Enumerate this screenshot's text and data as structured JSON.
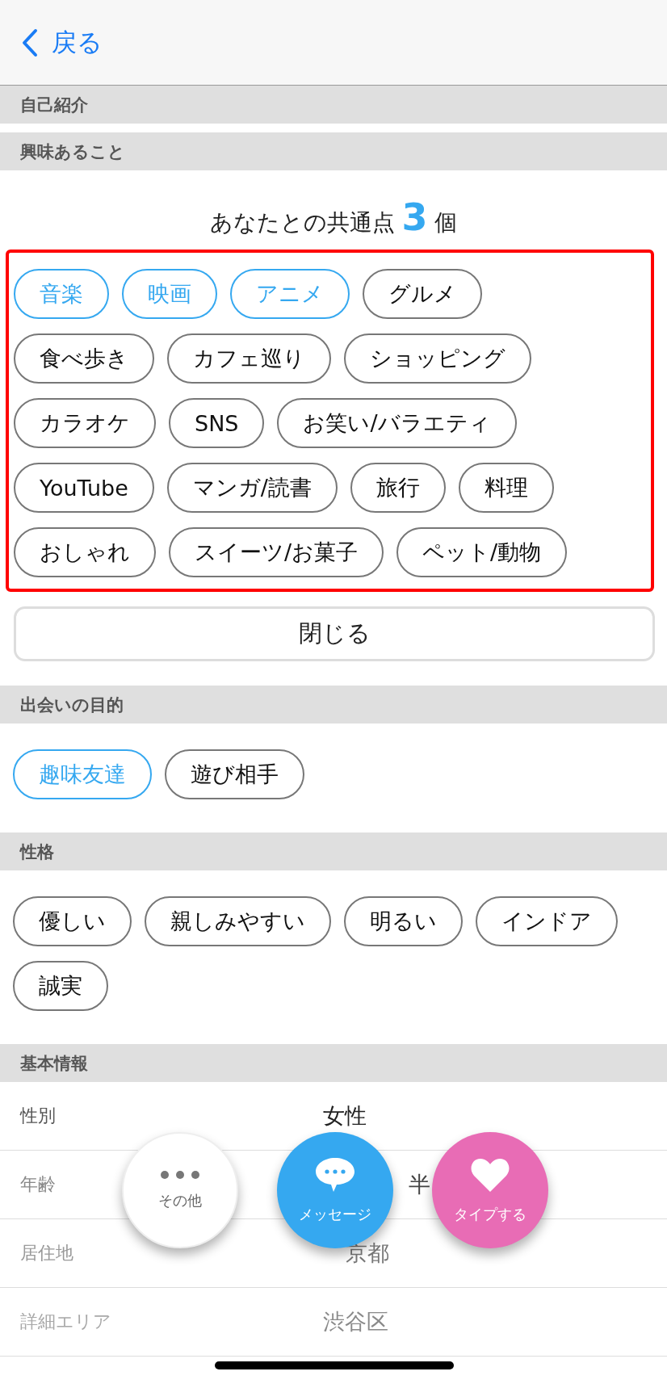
{
  "nav": {
    "back": "戻る"
  },
  "sections": [
    {
      "kind": "header",
      "title": "自己紹介"
    },
    {
      "kind": "interests",
      "title": "興味あること",
      "common": {
        "before": "あなたとの共通点",
        "count": "3",
        "after": "個"
      },
      "chips": [
        {
          "label": "音楽",
          "selected": true
        },
        {
          "label": "映画",
          "selected": true
        },
        {
          "label": "アニメ",
          "selected": true
        },
        {
          "label": "グルメ",
          "selected": false
        },
        {
          "label": "食べ歩き",
          "selected": false
        },
        {
          "label": "カフェ巡り",
          "selected": false
        },
        {
          "label": "ショッピング",
          "selected": false
        },
        {
          "label": "カラオケ",
          "selected": false
        },
        {
          "label": "SNS",
          "selected": false
        },
        {
          "label": "お笑い/バラエティ",
          "selected": false
        },
        {
          "label": "YouTube",
          "selected": false
        },
        {
          "label": "マンガ/読書",
          "selected": false
        },
        {
          "label": "旅行",
          "selected": false
        },
        {
          "label": "料理",
          "selected": false
        },
        {
          "label": "おしゃれ",
          "selected": false
        },
        {
          "label": "スイーツ/お菓子",
          "selected": false
        },
        {
          "label": "ペット/動物",
          "selected": false
        }
      ],
      "close": "閉じる"
    },
    {
      "kind": "chips",
      "title": "出会いの目的",
      "chips": [
        {
          "label": "趣味友達",
          "selected": true
        },
        {
          "label": "遊び相手",
          "selected": false
        }
      ]
    },
    {
      "kind": "chips",
      "title": "性格",
      "chips": [
        {
          "label": "優しい",
          "selected": false
        },
        {
          "label": "親しみやすい",
          "selected": false
        },
        {
          "label": "明るい",
          "selected": false
        },
        {
          "label": "インドア",
          "selected": false
        },
        {
          "label": "誠実",
          "selected": false
        }
      ]
    },
    {
      "kind": "info",
      "title": "基本情報",
      "rows": [
        {
          "label": "性別",
          "value": "女性",
          "kind": "full"
        },
        {
          "label": "年齢",
          "value": "半",
          "kind": "cut-long"
        },
        {
          "label": "居住地",
          "value": "京都",
          "kind": "cut-short"
        },
        {
          "label": "詳細エリア",
          "value": "渋谷区",
          "kind": "full"
        }
      ]
    }
  ],
  "actions": [
    {
      "kind": "more",
      "label": "その他"
    },
    {
      "kind": "message",
      "label": "メッセージ"
    },
    {
      "kind": "like",
      "label": "タイプする"
    }
  ]
}
